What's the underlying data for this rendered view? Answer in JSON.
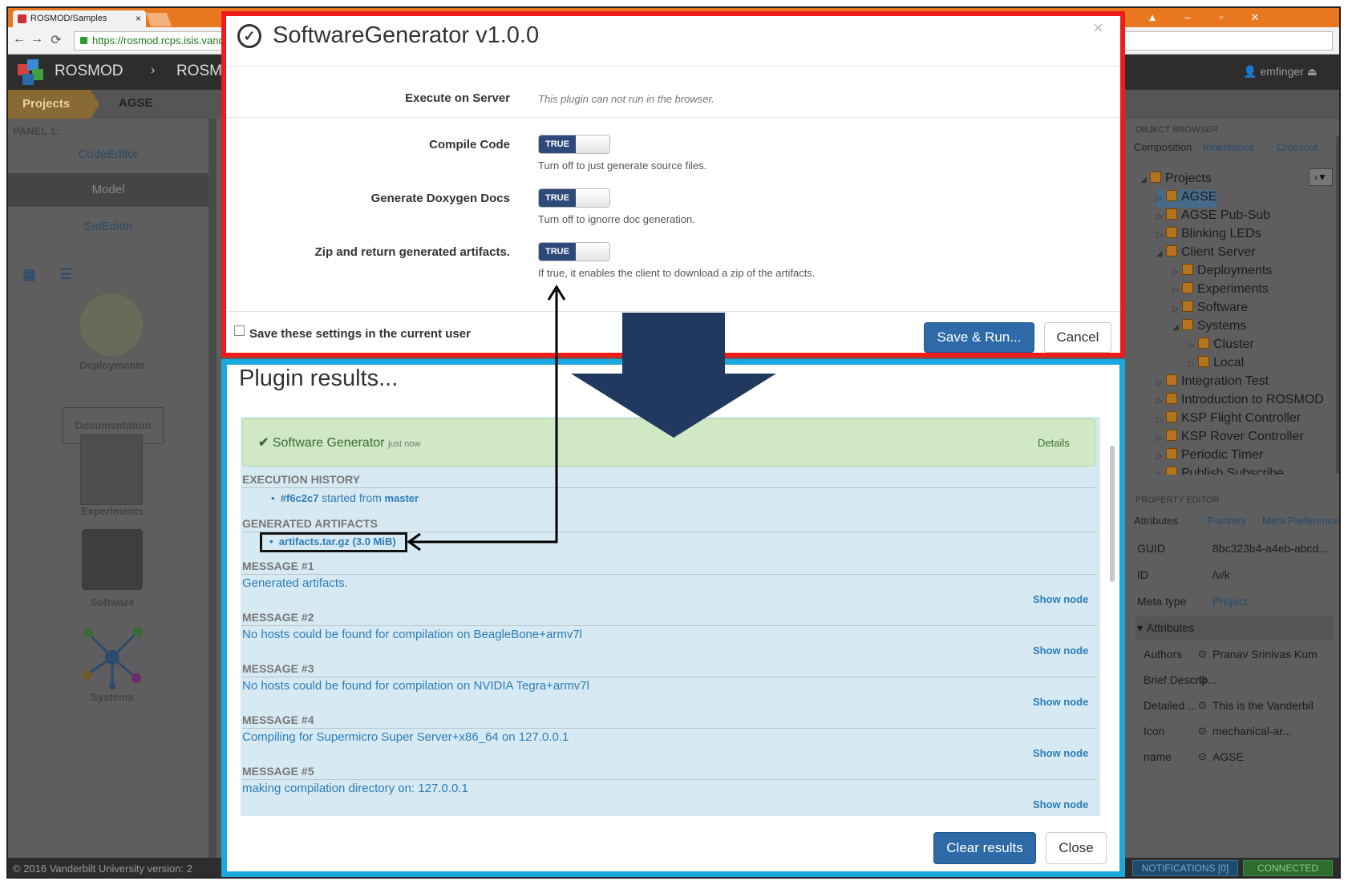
{
  "browser": {
    "tab_title": "ROSMOD/Samples",
    "tab_close": "×",
    "url": "https://rosmod.rcps.isis.vand",
    "back": "←",
    "forward": "→",
    "reload": "⟳"
  },
  "app": {
    "brand": "ROSMOD",
    "breadcrumb_sep": "›",
    "brand_second": "ROSM",
    "user": "emfinger",
    "projects_tab": "Projects",
    "current_project": "AGSE"
  },
  "left_panel": {
    "title": "PANEL 1:",
    "items": [
      "CodeEditor",
      "Model",
      "SetEditor"
    ],
    "selected": "Model",
    "view_grid_icon": "grid-icon",
    "view_list_icon": "list-icon",
    "tiles": [
      "Deployments",
      "Documentation",
      "Experiments",
      "Software",
      "Systems"
    ]
  },
  "object_browser": {
    "title": "OBJECT BROWSER",
    "tabs": [
      "Composition",
      "Inheritance",
      "Crosscut"
    ],
    "tree": [
      {
        "label": "Projects",
        "depth": 0,
        "caret": "◢"
      },
      {
        "label": "AGSE",
        "depth": 1,
        "caret": "▷",
        "selected": true
      },
      {
        "label": "AGSE Pub-Sub",
        "depth": 1,
        "caret": "▷"
      },
      {
        "label": "Blinking LEDs",
        "depth": 1,
        "caret": "▷"
      },
      {
        "label": "Client Server",
        "depth": 1,
        "caret": "◢"
      },
      {
        "label": "Deployments",
        "depth": 2,
        "caret": "▷"
      },
      {
        "label": "Experiments",
        "depth": 2,
        "caret": "▷"
      },
      {
        "label": "Software",
        "depth": 2,
        "caret": "▷"
      },
      {
        "label": "Systems",
        "depth": 2,
        "caret": "◢"
      },
      {
        "label": "Cluster",
        "depth": 3,
        "caret": "▷"
      },
      {
        "label": "Local",
        "depth": 3,
        "caret": "▷"
      },
      {
        "label": "Integration Test",
        "depth": 1,
        "caret": "▷"
      },
      {
        "label": "Introduction to ROSMOD",
        "depth": 1,
        "caret": "▷"
      },
      {
        "label": "KSP Flight Controller",
        "depth": 1,
        "caret": "▷"
      },
      {
        "label": "KSP Rover Controller",
        "depth": 1,
        "caret": "▷"
      },
      {
        "label": "Periodic Timer",
        "depth": 1,
        "caret": "▷"
      },
      {
        "label": "Publish Subscribe",
        "depth": 1,
        "caret": "▷"
      }
    ]
  },
  "property_editor": {
    "title": "PROPERTY EDITOR",
    "tabs": [
      "Attributes",
      "Pointers",
      "Meta",
      "Preferences"
    ],
    "rows": [
      {
        "key": "GUID",
        "value": "8bc323b4-a4eb-abcd..."
      },
      {
        "key": "ID",
        "value": "/v/k"
      },
      {
        "key": "Meta type",
        "value": "Project"
      }
    ],
    "group": "Attributes",
    "attributes": [
      {
        "key": "Authors",
        "value": "Pranav Srinivas Kum"
      },
      {
        "key": "Brief Descrip...",
        "value": ""
      },
      {
        "key": "Detailed ...",
        "value": "This is the Vanderbil"
      },
      {
        "key": "Icon",
        "value": "mechanical-ar..."
      },
      {
        "key": "name",
        "value": "AGSE"
      }
    ]
  },
  "footer": {
    "copyright": "© 2016 Vanderbilt University  version: 2",
    "notifications": "NOTIFICATIONS [0]",
    "connected": "CONNECTED"
  },
  "plugin_dialog": {
    "title": "SoftwareGenerator v1.0.0",
    "close": "×",
    "fields": [
      {
        "label": "Execute on Server",
        "help": "This plugin can not run in the browser."
      },
      {
        "label": "Compile Code",
        "toggle": "TRUE",
        "desc": "Turn off to just generate source files."
      },
      {
        "label": "Generate Doxygen Docs",
        "toggle": "TRUE",
        "desc": "Turn off to ignorre doc generation."
      },
      {
        "label": "Zip and return generated artifacts.",
        "toggle": "TRUE",
        "desc": "If true, it enables the client to download a zip of the artifacts."
      }
    ],
    "save_settings": "Save these settings in the current user",
    "save_run": "Save & Run...",
    "cancel": "Cancel"
  },
  "results_dialog": {
    "title": "Plugin results...",
    "success_name": "Software Generator",
    "success_time": "just now",
    "details": "Details",
    "execution_history_head": "EXECUTION HISTORY",
    "commit": "#f6c2c7",
    "started_from": "started from",
    "branch": "master",
    "artifacts_head": "GENERATED ARTIFACTS",
    "artifact": "artifacts.tar.gz (3.0 MiB)",
    "messages": [
      {
        "head": "MESSAGE #1",
        "text": "Generated artifacts."
      },
      {
        "head": "MESSAGE #2",
        "text": "No hosts could be found for compilation on BeagleBone+armv7l"
      },
      {
        "head": "MESSAGE #3",
        "text": "No hosts could be found for compilation on NVIDIA Tegra+armv7l"
      },
      {
        "head": "MESSAGE #4",
        "text": "Compiling for Supermicro Super Server+x86_64 on 127.0.0.1"
      },
      {
        "head": "MESSAGE #5",
        "text": "making compilation directory on: 127.0.0.1"
      }
    ],
    "show_node": "Show node",
    "clear": "Clear results",
    "close": "Close"
  }
}
